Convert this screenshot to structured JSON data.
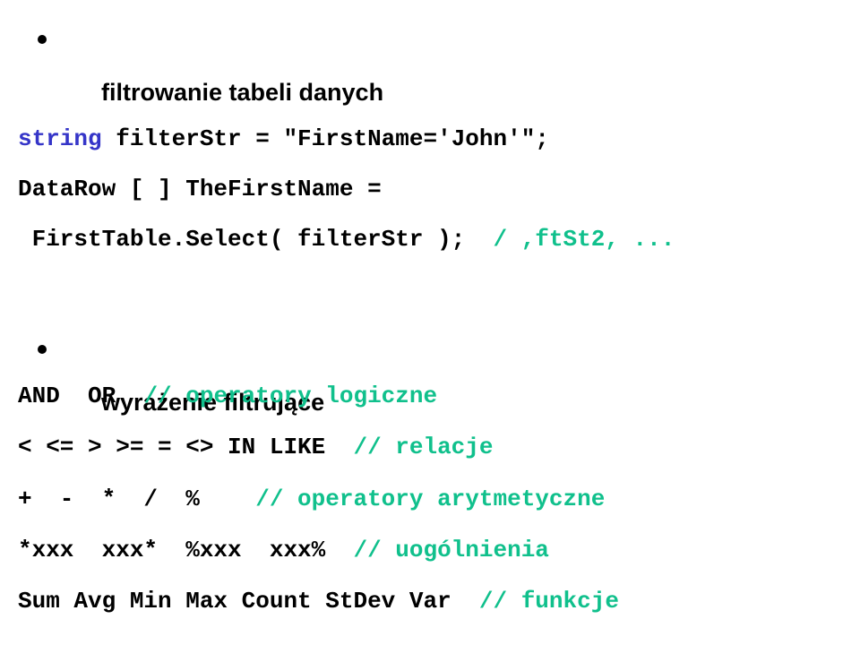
{
  "colors": {
    "text": "#000000",
    "keyword": "#3535c8",
    "comment": "#10c08c",
    "background": "#ffffff"
  },
  "section1": {
    "bullet_icon": "bullet",
    "heading": "filtrowanie tabeli danych"
  },
  "code1": {
    "line1": {
      "keyword": "string",
      "rest": " filterStr = \"FirstName='John'\";"
    },
    "line2": {
      "text": "DataRow [ ] TheFirstName ="
    },
    "line3": {
      "text": " FirstTable.Select( filterStr );  ",
      "comment": "/ ,ftSt2, ..."
    }
  },
  "section2": {
    "bullet_icon": "bullet",
    "heading": "wyrażenie filtrujące"
  },
  "code2": {
    "lines": [
      {
        "code": "AND  OR  ",
        "comment": "// operatory logiczne"
      },
      {
        "code": "< <= > >= = <> IN LIKE  ",
        "comment": "// relacje"
      },
      {
        "code": "+  -  *  /  %    ",
        "comment": "// operatory arytmetyczne"
      },
      {
        "code": "*xxx  xxx*  %xxx  xxx%  ",
        "comment": "// uogólnienia"
      },
      {
        "code": "Sum Avg Min Max Count StDev Var  ",
        "comment": "// funkcje"
      }
    ]
  }
}
